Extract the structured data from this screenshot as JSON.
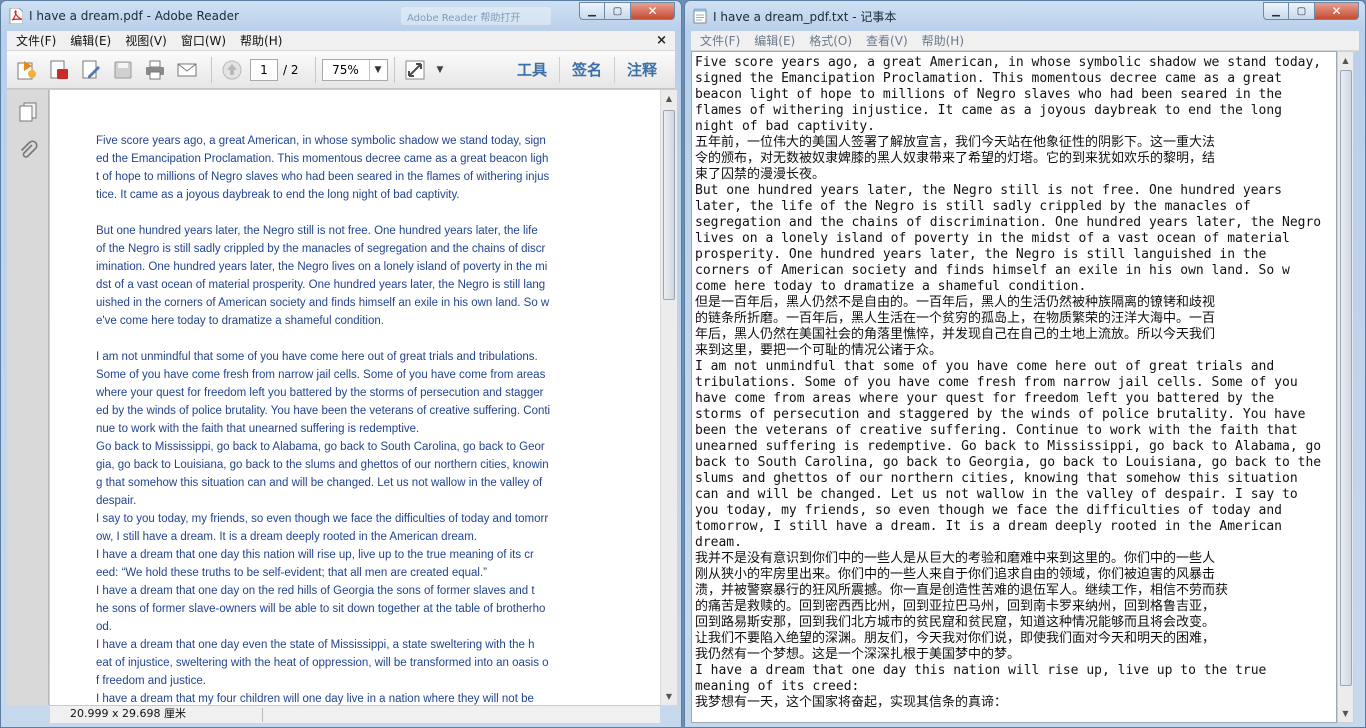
{
  "adobe": {
    "title": "I have a dream.pdf - Adobe Reader",
    "ghost_tab": "Adobe Reader 帮助打开",
    "menu": [
      "文件(F)",
      "编辑(E)",
      "视图(V)",
      "窗口(W)",
      "帮助(H)"
    ],
    "doc_close": "×",
    "toolbar": {
      "page_current": "1",
      "page_total": "/ 2",
      "zoom": "75%",
      "right_labels": [
        "工具",
        "签名",
        "注释"
      ]
    },
    "status_size": "20.999 x 29.698 厘米",
    "paragraphs": [
      "Five score years ago, a great American, in whose symbolic shadow we stand today, sign\ned the Emancipation Proclamation. This momentous decree came as a great beacon ligh\nt of hope to millions of Negro slaves who had been seared in the flames of withering injus\ntice. It came as a joyous daybreak to end the long night of bad captivity.",
      "    But one hundred years later, the Negro still is not free. One hundred years later, the life\n of the Negro is still sadly crippled by the manacles of segregation and the chains of discr\nimination. One hundred years later, the Negro lives on a lonely island of poverty in the mi\ndst of a vast ocean of material prosperity. One hundred years later, the Negro is still lang\nuished in the corners of American society and finds himself an exile in his own land. So w\ne've come here today to dramatize a shameful condition.",
      "    I am not unmindful that some of you have come here out of great trials and tribulations.\n Some of you have come fresh from narrow jail cells. Some of you have come from areas\n where your quest for freedom left you battered by the storms of persecution and stagger\ned by the winds of police brutality. You have been the veterans of creative suffering. Conti\nnue to work with the faith that unearned suffering is redemptive.",
      "Go back to Mississippi, go back to Alabama, go back to South Carolina, go back to Geor\ngia, go back to Louisiana, go back to the slums and ghettos of our northern cities, knowin\ng that somehow this situation can and will be changed. Let us not wallow in the valley of\ndespair.",
      "I say to you today, my friends, so even though we face the difficulties of today and tomorr\now, I still have a dream. It is a dream deeply rooted in the American dream.",
      "    I have a dream that one day this nation will rise up, live up to the true meaning of its cr\need: “We hold these truths to be self-evident; that all men are created equal.”",
      "    I have a dream that one day on the red hills of Georgia the sons of former slaves and t\nhe sons of former slave-owners will be able to sit down together at the table of brotherho\nod.",
      "    I have a dream that one day even the state of Mississippi, a state sweltering with the h\neat of injustice, sweltering with the heat of oppression, will be transformed into an oasis o\nf freedom and justice.",
      "    I have a dream that my four children will one day live in a nation where they will not be"
    ]
  },
  "notepad": {
    "title": "I have a dream_pdf.txt - 记事本",
    "menu": [
      "文件(F)",
      "编辑(E)",
      "格式(O)",
      "查看(V)",
      "帮助(H)"
    ],
    "text": "Five score years ago, a great American, in whose symbolic shadow we stand today,\nsigned the Emancipation Proclamation. This momentous decree came as a great\nbeacon light of hope to millions of Negro slaves who had been seared in the\nflames of withering injustice. It came as a joyous daybreak to end the long\nnight of bad captivity.\n五年前，一位伟大的美国人签署了解放宣言，我们今天站在他象征性的阴影下。这一重大法\n令的颁布，对无数被奴隶婢膝的黑人奴隶带来了希望的灯塔。它的到来犹如欢乐的黎明，结\n束了囚禁的漫漫长夜。\nBut one hundred years later, the Negro still is not free. One hundred years\nlater, the life of the Negro is still sadly crippled by the manacles of\nsegregation and the chains of discrimination. One hundred years later, the Negro\nlives on a lonely island of poverty in the midst of a vast ocean of material\nprosperity. One hundred years later, the Negro is still languished in the\ncorners of American society and finds himself an exile in his own land. So w\ncome here today to dramatize a shameful condition.\n但是一百年后，黑人仍然不是自由的。一百年后，黑人的生活仍然被种族隔离的镣铐和歧视\n的链条所折磨。一百年后，黑人生活在一个贫穷的孤岛上，在物质繁荣的汪洋大海中。一百\n年后，黑人仍然在美国社会的角落里憔悴，并发现自己在自己的土地上流放。所以今天我们\n来到这里，要把一个可耻的情况公诸于众。\nI am not unmindful that some of you have come here out of great trials and\ntribulations. Some of you have come fresh from narrow jail cells. Some of you\nhave come from areas where your quest for freedom left you battered by the\nstorms of persecution and staggered by the winds of police brutality. You have\nbeen the veterans of creative suffering. Continue to work with the faith that\nunearned suffering is redemptive. Go back to Mississippi, go back to Alabama, go\nback to South Carolina, go back to Georgia, go back to Louisiana, go back to the\nslums and ghettos of our northern cities, knowing that somehow this situation\ncan and will be changed. Let us not wallow in the valley of despair. I say to\nyou today, my friends, so even though we face the difficulties of today and\ntomorrow, I still have a dream. It is a dream deeply rooted in the American\ndream.\n我并不是没有意识到你们中的一些人是从巨大的考验和磨难中来到这里的。你们中的一些人\n刚从狭小的牢房里出来。你们中的一些人来自于你们追求自由的领域，你们被迫害的风暴击\n溃，并被警察暴行的狂风所震撼。你一直是创造性苦难的退伍军人。继续工作，相信不劳而获\n的痛苦是救赎的。回到密西西比州，回到亚拉巴马州，回到南卡罗来纳州，回到格鲁吉亚，\n回到路易斯安那，回到我们北方城市的贫民窟和贫民窟，知道这种情况能够而且将会改变。\n让我们不要陷入绝望的深渊。朋友们，今天我对你们说，即使我们面对今天和明天的困难，\n我仍然有一个梦想。这是一个深深扎根于美国梦中的梦。\nI have a dream that one day this nation will rise up, live up to the true\nmeaning of its creed:\n我梦想有一天，这个国家将奋起，实现其信条的真谛："
  }
}
